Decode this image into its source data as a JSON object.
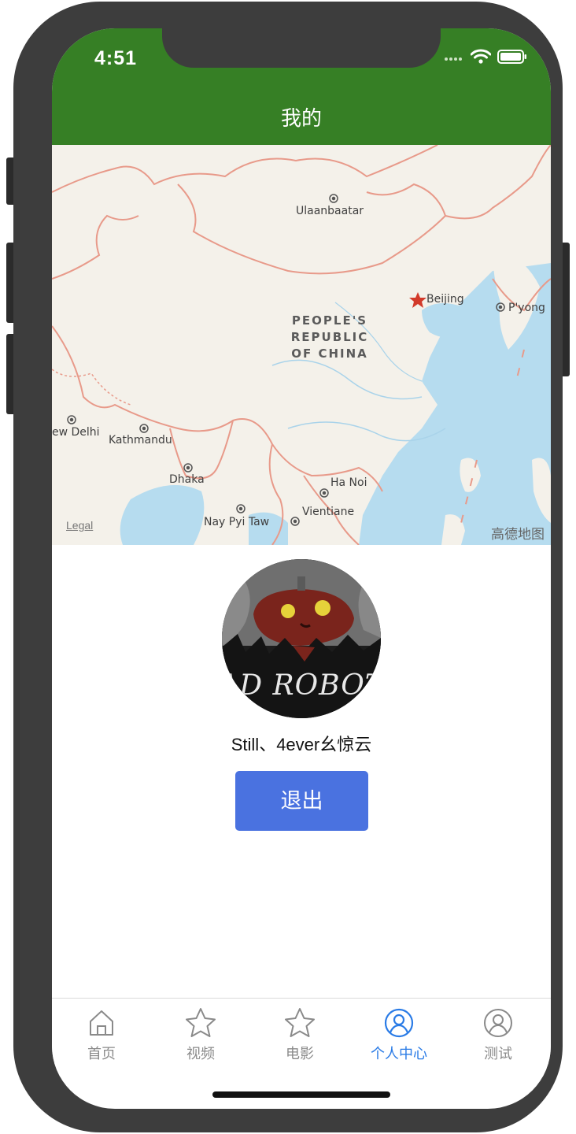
{
  "status_bar": {
    "time": "4:51"
  },
  "header": {
    "title": "我的"
  },
  "map": {
    "labels": {
      "ulaanbaatar": "Ulaanbaatar",
      "beijing": "Beijing",
      "pyongyang": "P'yong",
      "new_delhi": "ew Delhi",
      "kathmandu": "Kathmandu",
      "dhaka": "Dhaka",
      "hanoi": "Ha Noi",
      "vientiane": "Vientiane",
      "naypyitaw": "Nay Pyi Taw"
    },
    "country": {
      "line1": "PEOPLE'S",
      "line2": "REPUBLIC",
      "line3": "OF CHINA"
    },
    "legal": "Legal",
    "attribution": "高德地图"
  },
  "profile": {
    "avatar_text": "AD ROBOT",
    "username": "Still、4ever幺惊云",
    "logout_label": "退出"
  },
  "tabs": [
    {
      "label": "首页",
      "icon": "home-icon"
    },
    {
      "label": "视频",
      "icon": "star-icon"
    },
    {
      "label": "电影",
      "icon": "star-icon"
    },
    {
      "label": "个人中心",
      "icon": "user-icon"
    },
    {
      "label": "测试",
      "icon": "user-icon"
    }
  ],
  "colors": {
    "header": "#367f25",
    "active_tab": "#2a7be6",
    "button": "#4a72e0"
  }
}
